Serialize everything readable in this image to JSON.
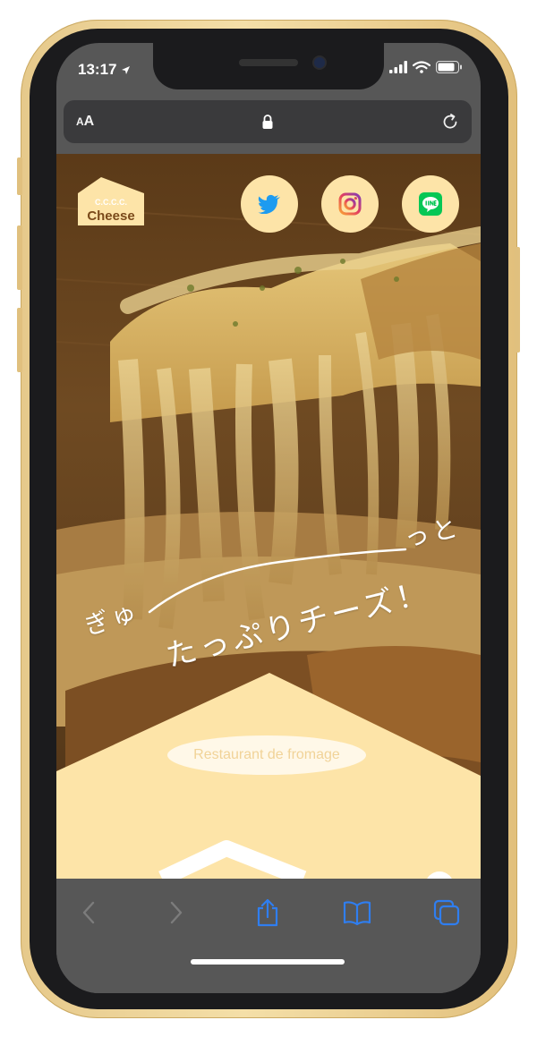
{
  "status_bar": {
    "time": "13:17"
  },
  "browser": {
    "text_size_label_small": "A",
    "text_size_label_large": "A"
  },
  "site": {
    "logo_line1": "C.C.C.C.",
    "logo_line2": "Cheese",
    "tagline_part1": "ぎゅ",
    "tagline_part2": "っと",
    "tagline_part3": "たっぷりチーズ！",
    "restaurant_label": "Restaurant de fromage"
  },
  "social": [
    "twitter-icon",
    "instagram-icon",
    "line-icon"
  ],
  "colors": {
    "accent": "#fde4a8",
    "toolbar": "#575757",
    "link_blue": "#2f7ef0"
  }
}
